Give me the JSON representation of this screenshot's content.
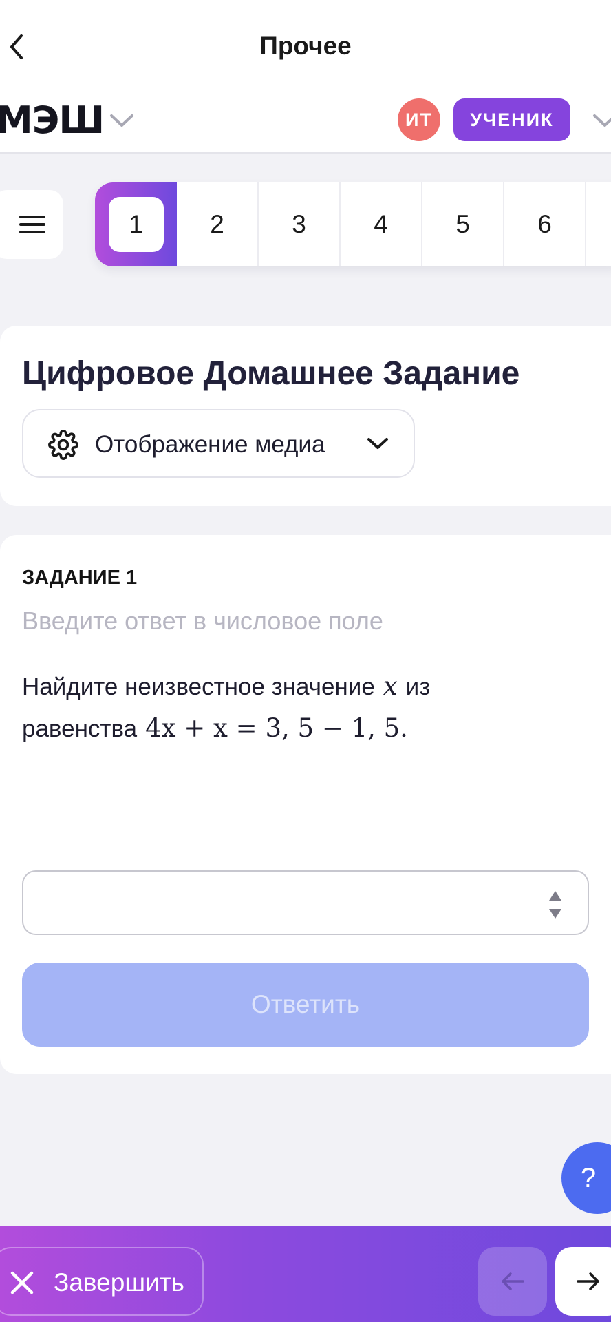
{
  "topbar": {
    "title": "Прочее"
  },
  "header": {
    "logo": "МЭШ",
    "avatar_initials": "ИТ",
    "role": "УЧЕНИК"
  },
  "tabs": [
    "1",
    "2",
    "3",
    "4",
    "5",
    "6"
  ],
  "active_tab": "1",
  "section": {
    "title": "Цифровое Домашнее Задание",
    "media_label": "Отображение медиа"
  },
  "task": {
    "number_label": "ЗАДАНИЕ 1",
    "hint": "Введите ответ в числовое поле",
    "text_part1": "Найдите неизвестное значение",
    "var": "x",
    "text_part2": "из",
    "text_part3": "равенства",
    "equation": "4x + x = 3, 5 − 1, 5.",
    "answer_value": "",
    "submit_label": "Ответить"
  },
  "help": {
    "label": "?"
  },
  "bottombar": {
    "finish_label": "Завершить"
  },
  "colors": {
    "accent_purple": "#8544dd",
    "gradient_start": "#b24ddc",
    "gradient_end": "#6e49dd",
    "avatar_bg": "#ef6f6c",
    "submit_disabled": "#a4b4f6",
    "help_blue": "#4c6bf0"
  },
  "icons": {
    "back": "chevron-left-icon",
    "logo_dropdown": "chevron-down-icon",
    "menu": "hamburger-icon",
    "media": "gear-icon",
    "finish": "close-icon",
    "prev": "arrow-left-icon",
    "next": "arrow-right-icon"
  }
}
